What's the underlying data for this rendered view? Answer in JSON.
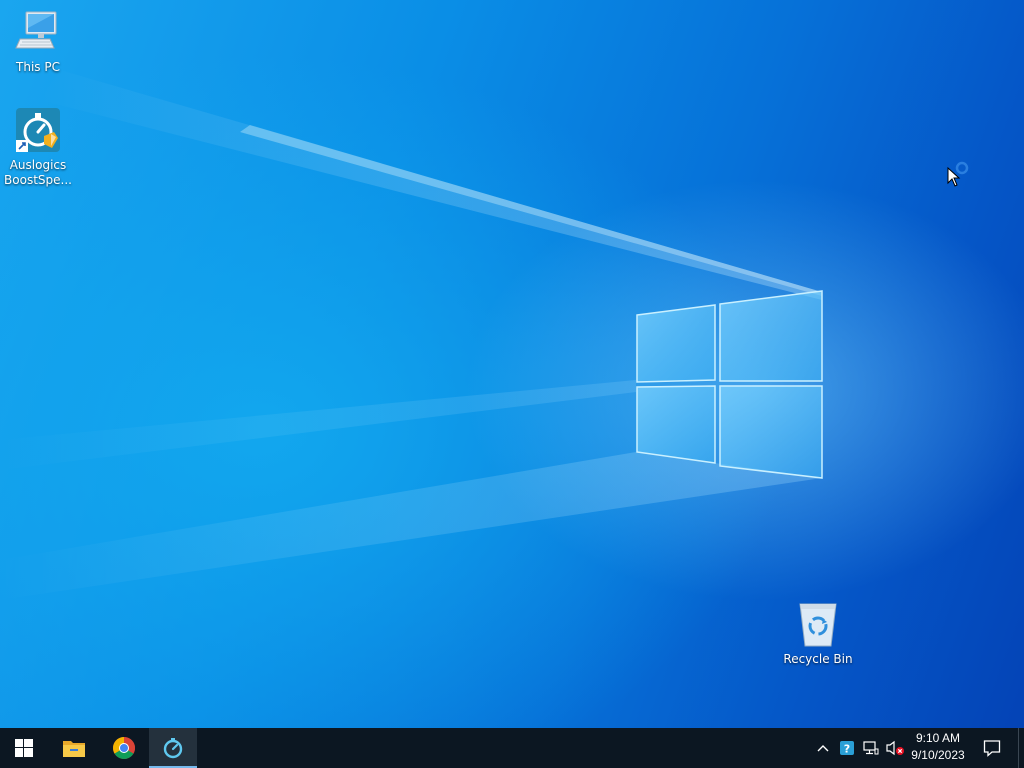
{
  "desktop": {
    "icons": [
      {
        "label": "This PC",
        "icon": "computer-monitor-icon"
      },
      {
        "label": "Auslogics BoostSpe...",
        "icon": "auslogics-boostspeed-icon"
      },
      {
        "label": "Recycle Bin",
        "icon": "recycle-bin-icon"
      }
    ],
    "wallpaper": "windows-10-hero-wallpaper"
  },
  "taskbar": {
    "pinned": [
      {
        "icon": "windows-start-icon"
      },
      {
        "icon": "file-explorer-icon"
      },
      {
        "icon": "google-chrome-icon"
      },
      {
        "icon": "auslogics-boostspeed-icon",
        "active": true
      }
    ],
    "tray": {
      "icons": [
        "chevron-up-icon",
        "help-question-icon",
        "network-icon",
        "volume-muted-icon"
      ],
      "time": "9:10 AM",
      "date": "9/10/2023"
    },
    "notification_icon": "action-center-icon"
  },
  "colors": {
    "taskbar_bg": "#0c1722",
    "accent": "#76b9ed",
    "desktop_blue": "#0a8ee6"
  }
}
